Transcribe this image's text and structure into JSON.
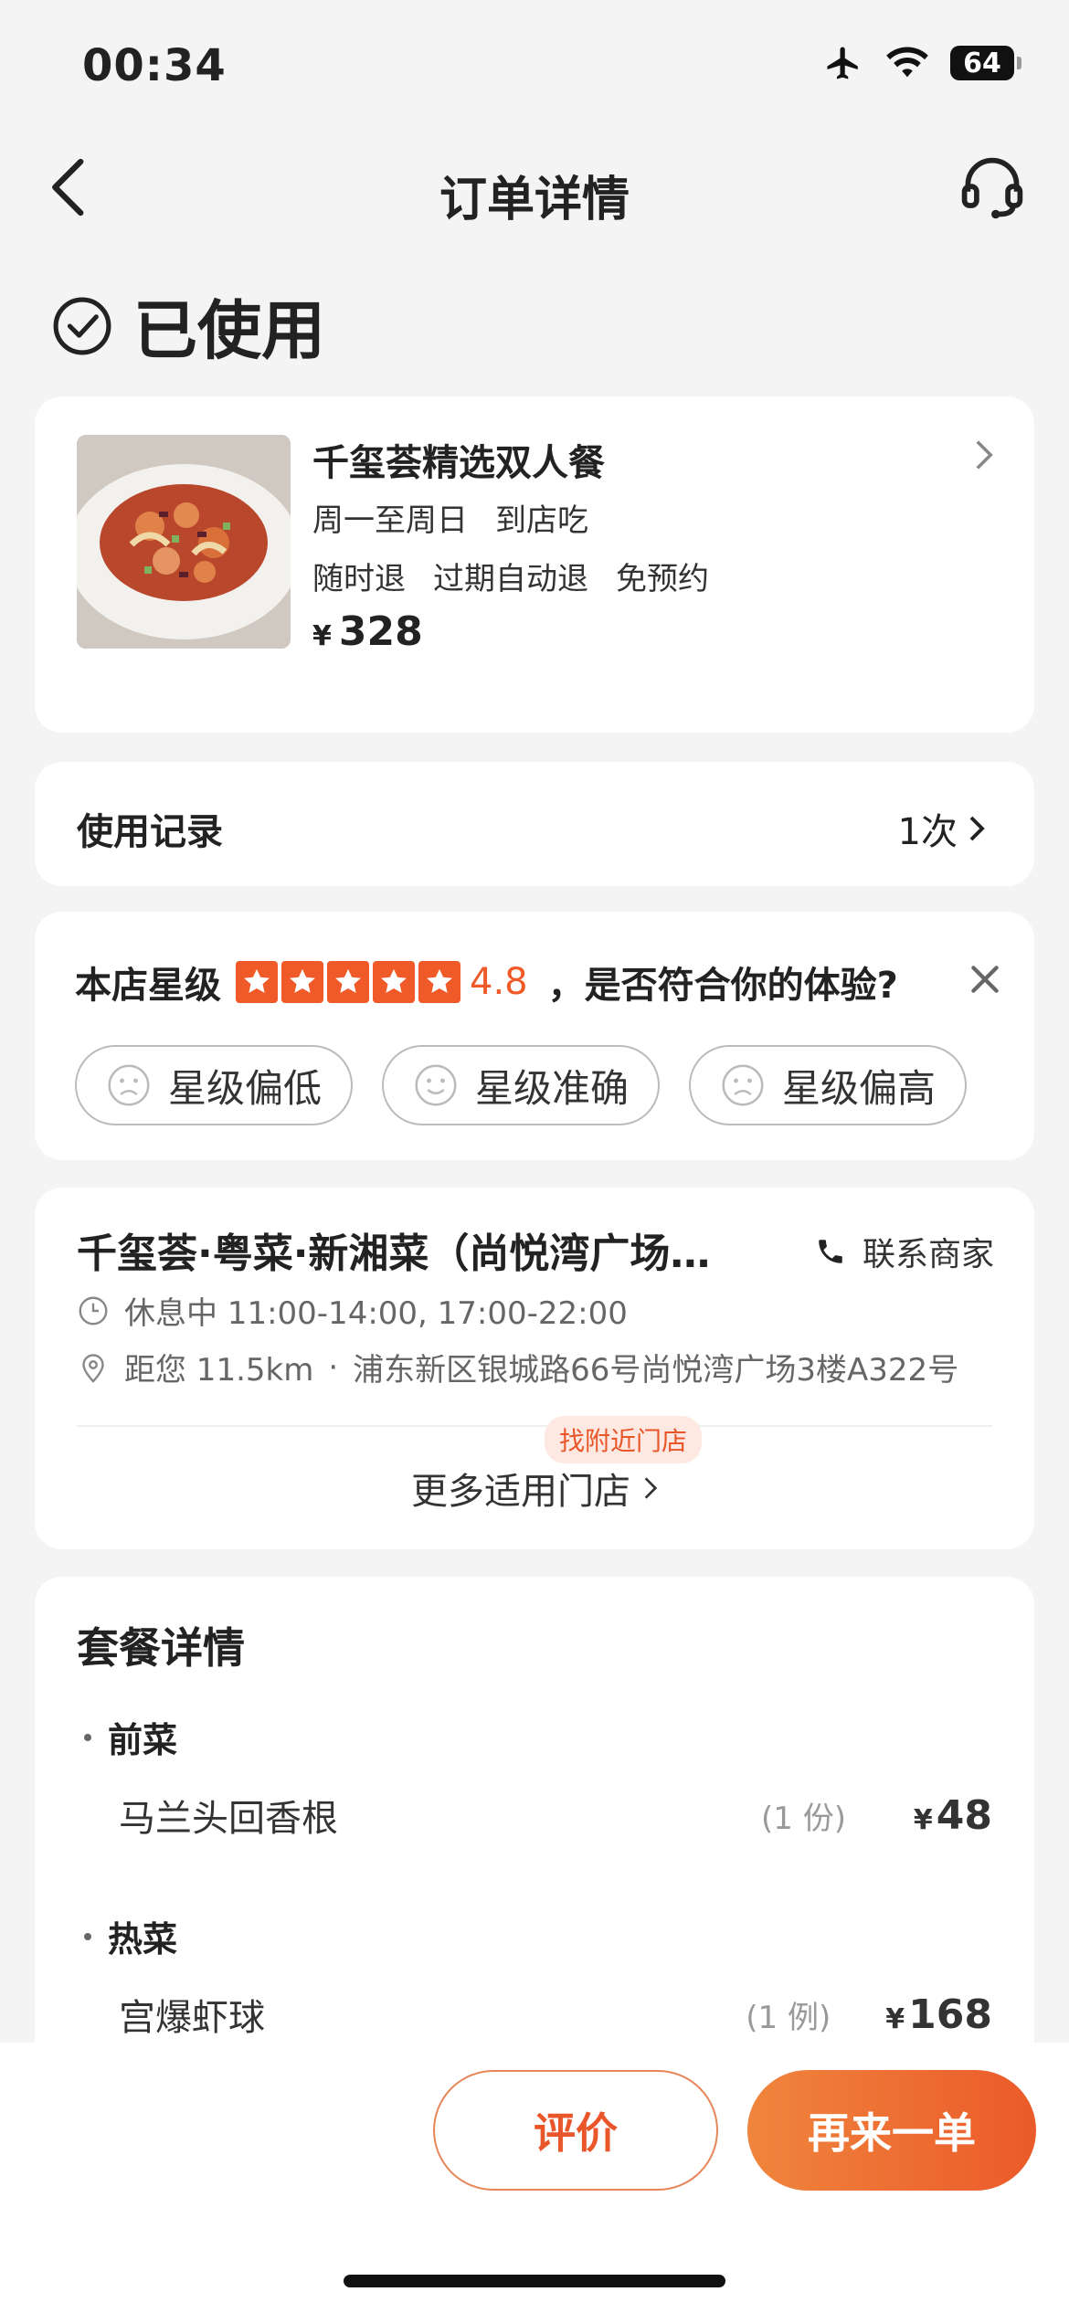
{
  "status_bar": {
    "time": "00:34",
    "battery": "64"
  },
  "nav": {
    "title": "订单详情"
  },
  "order_status": {
    "text": "已使用"
  },
  "product": {
    "name": "千玺荟精选双人餐",
    "tags_line1": [
      "周一至周日",
      "到店吃"
    ],
    "tags_line2": [
      "随时退",
      "过期自动退",
      "免预约"
    ],
    "price_symbol": "¥",
    "price": "328"
  },
  "usage_record": {
    "label": "使用记录",
    "value": "1次"
  },
  "rating": {
    "label": "本店星级",
    "stars": 5,
    "score": "4.8",
    "question": "，是否符合你的体验?",
    "options": [
      "星级偏低",
      "星级准确",
      "星级偏高"
    ]
  },
  "store": {
    "name": "千玺荟·粤菜·新湘菜（尚悦湾广场…",
    "contact_label": "联系商家",
    "hours": "休息中 11:00-14:00, 17:00-22:00",
    "distance": "距您 11.5km",
    "address": "浦东新区银城路66号尚悦湾广场3楼A322号",
    "nearby_badge": "找附近门店",
    "more_stores": "更多适用门店"
  },
  "package": {
    "title": "套餐详情",
    "categories": [
      {
        "name": "前菜",
        "items": [
          {
            "name": "马兰头回香根",
            "qty": "(1 份)",
            "price_symbol": "¥",
            "price": "48"
          }
        ]
      },
      {
        "name": "热菜",
        "items": [
          {
            "name": "宫爆虾球",
            "qty": "(1 例)",
            "price_symbol": "¥",
            "price": "168"
          }
        ]
      }
    ]
  },
  "actions": {
    "review": "评价",
    "reorder": "再来一单"
  },
  "colors": {
    "accent": "#f05a28",
    "button_gradient_start": "#f0853d",
    "button_gradient_end": "#eb5a2a"
  }
}
